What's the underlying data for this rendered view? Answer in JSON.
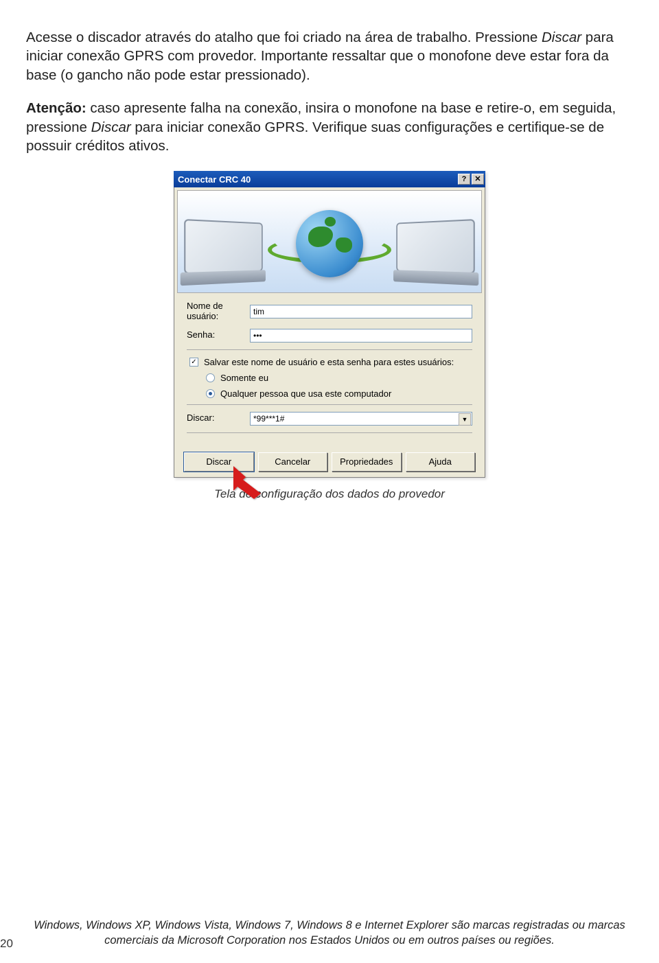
{
  "text": {
    "p1a": "Acesse o discador através do atalho que foi criado na área de trabalho. Pressione ",
    "p1b": "Discar",
    "p1c": " para iniciar conexão GPRS com provedor. Importante ressaltar que o monofone deve estar fora da base (o gancho não pode estar pressionado).",
    "p2a": "Atenção:",
    "p2b": " caso apresente falha na conexão, insira o monofone na base e retire-o, em seguida, pressione ",
    "p2c": "Discar",
    "p2d": " para iniciar conexão GPRS. Verifique suas configurações e certifique-se de possuir créditos ativos."
  },
  "dialog": {
    "title": "Conectar CRC 40",
    "help_glyph": "?",
    "close_glyph": "✕",
    "username_label": "Nome de usuário:",
    "username_value": "tim",
    "password_label": "Senha:",
    "password_value": "•••",
    "save_chk_label": "Salvar este nome de usuário e esta senha para estes usuários:",
    "radio1_label": "Somente eu",
    "radio2_label": "Qualquer pessoa que usa este computador",
    "dial_label": "Discar:",
    "dial_value": "*99***1#",
    "btn_dial": "Discar",
    "btn_cancel": "Cancelar",
    "btn_props": "Propriedades",
    "btn_help": "Ajuda"
  },
  "caption": "Tela de configuração dos dados do provedor",
  "footer": "Windows, Windows XP, Windows Vista, Windows 7, Windows 8 e Internet Explorer são marcas registradas ou marcas comerciais da Microsoft Corporation nos Estados Unidos ou em outros países ou regiões.",
  "pagenum": "20"
}
